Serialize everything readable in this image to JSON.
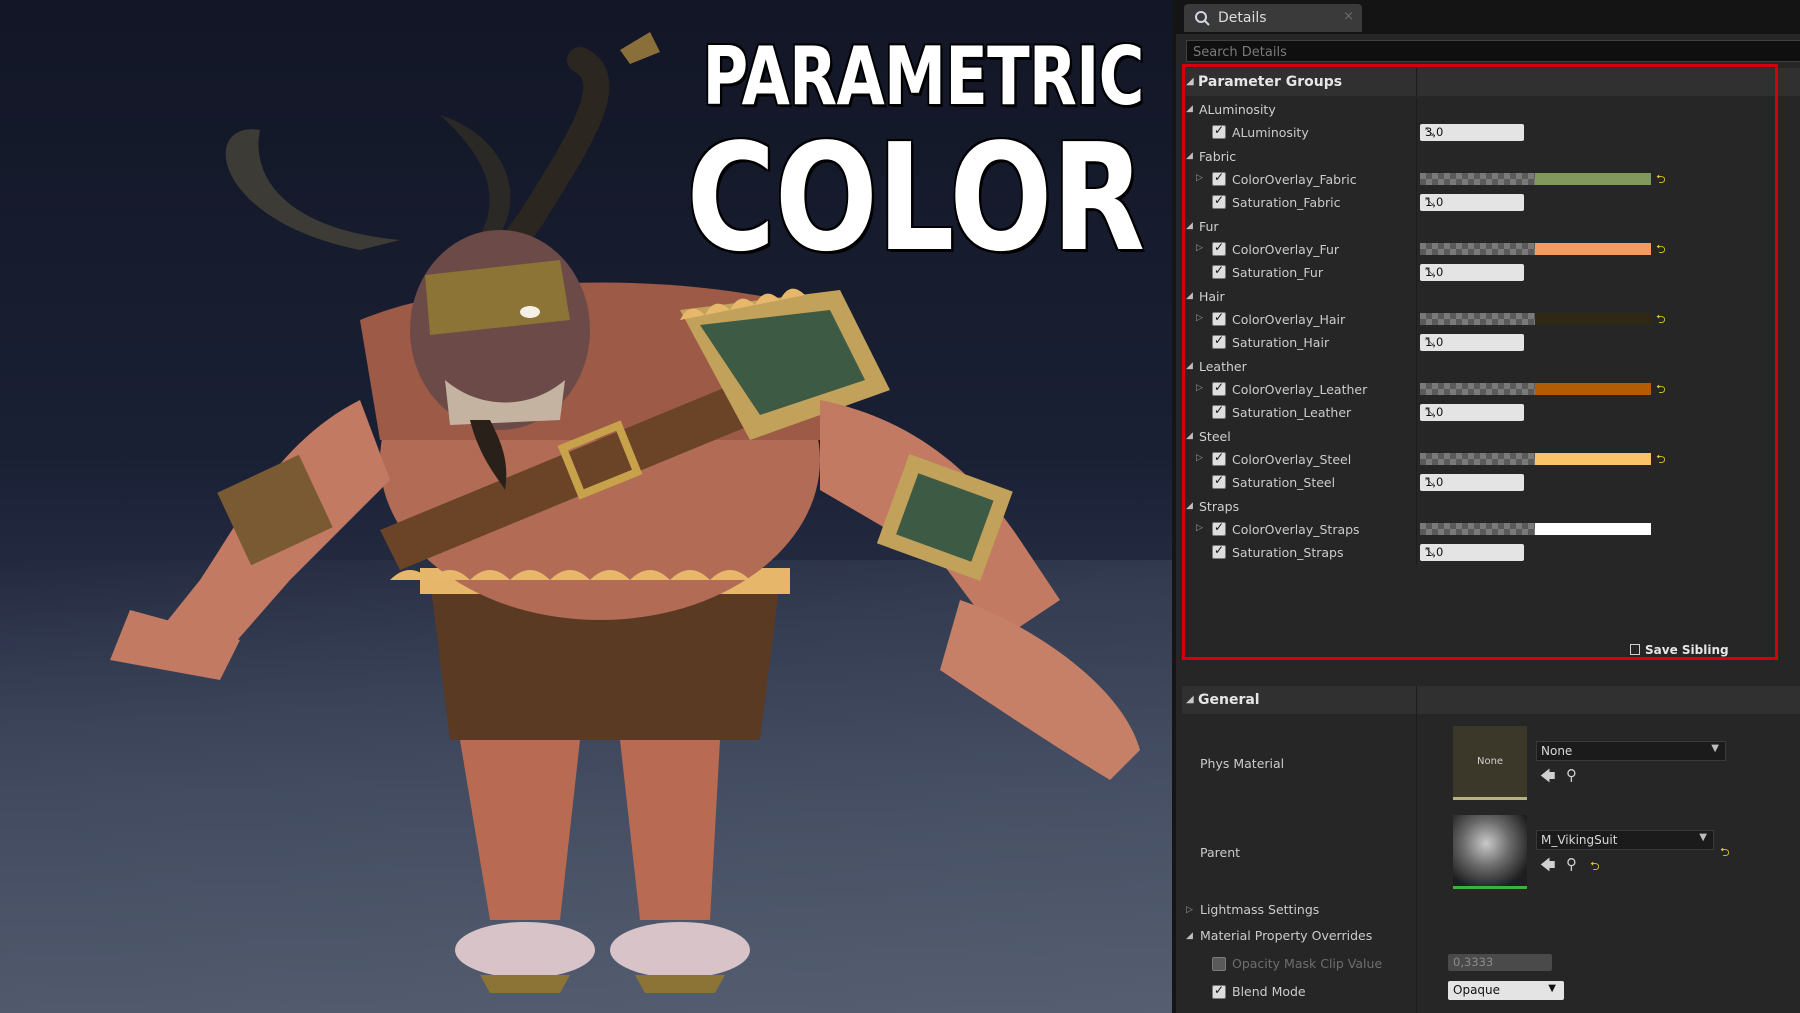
{
  "viewport": {
    "title_line1": "PARAMETRIC",
    "title_line2": "COLOR"
  },
  "details": {
    "tab_label": "Details",
    "tab_close": "×",
    "search_placeholder": "Search Details",
    "parameter_groups_label": "Parameter Groups",
    "groups": [
      {
        "name": "ALuminosity",
        "params": [
          {
            "type": "scalar",
            "label": "ALuminosity",
            "value": "3,0"
          }
        ]
      },
      {
        "name": "Fabric",
        "params": [
          {
            "type": "color",
            "label": "ColorOverlay_Fabric",
            "color": "#7f9a5c"
          },
          {
            "type": "scalar",
            "label": "Saturation_Fabric",
            "value": "1,0"
          }
        ]
      },
      {
        "name": "Fur",
        "params": [
          {
            "type": "color",
            "label": "ColorOverlay_Fur",
            "color": "#f49c5f"
          },
          {
            "type": "scalar",
            "label": "Saturation_Fur",
            "value": "1,0"
          }
        ]
      },
      {
        "name": "Hair",
        "params": [
          {
            "type": "color",
            "label": "ColorOverlay_Hair",
            "color": "#2e2814"
          },
          {
            "type": "scalar",
            "label": "Saturation_Hair",
            "value": "1,0"
          }
        ]
      },
      {
        "name": "Leather",
        "params": [
          {
            "type": "color",
            "label": "ColorOverlay_Leather",
            "color": "#b25d05"
          },
          {
            "type": "scalar",
            "label": "Saturation_Leather",
            "value": "1,0"
          }
        ]
      },
      {
        "name": "Steel",
        "params": [
          {
            "type": "color",
            "label": "ColorOverlay_Steel",
            "color": "#fbc26a"
          },
          {
            "type": "scalar",
            "label": "Saturation_Steel",
            "value": "1,0"
          }
        ]
      },
      {
        "name": "Straps",
        "params": [
          {
            "type": "color",
            "label": "ColorOverlay_Straps",
            "color": "#ffffff"
          },
          {
            "type": "scalar",
            "label": "Saturation_Straps",
            "value": "1,0"
          }
        ]
      }
    ],
    "save_button": "Save Sibling",
    "general": {
      "header": "General",
      "phys_material_label": "Phys Material",
      "phys_material_thumb": "None",
      "phys_material_value": "None",
      "parent_label": "Parent",
      "parent_value": "M_VikingSuit",
      "lightmass_label": "Lightmass Settings",
      "overrides_label": "Material Property Overrides",
      "opacity_mask_label": "Opacity Mask Clip Value",
      "opacity_mask_value": "0,3333",
      "blend_mode_label": "Blend Mode",
      "blend_mode_value": "Opaque"
    }
  }
}
